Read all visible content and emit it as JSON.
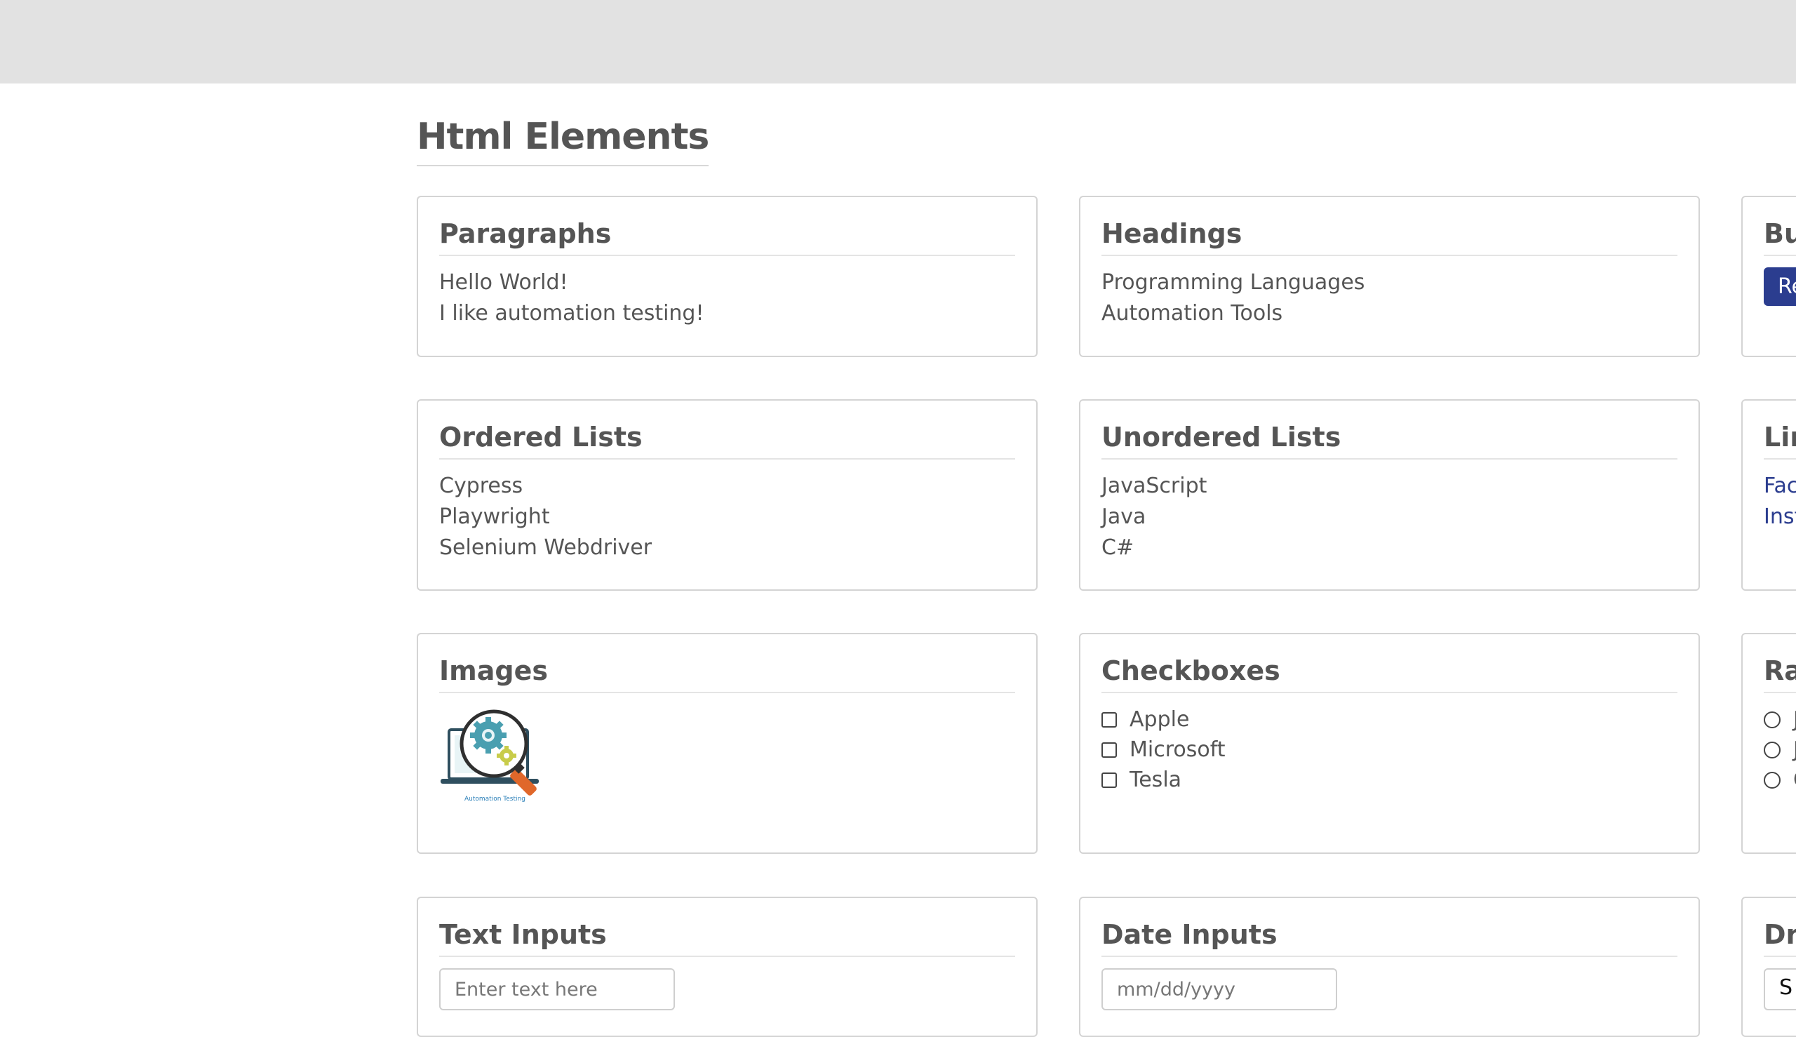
{
  "page": {
    "title": "Html Elements"
  },
  "cards": {
    "paragraphs": {
      "title": "Paragraphs",
      "lines": [
        "Hello World!",
        "I like automation testing!"
      ]
    },
    "headings": {
      "title": "Headings",
      "lines": [
        "Programming Languages",
        "Automation Tools"
      ]
    },
    "buttons": {
      "title": "Bu",
      "button_label": "Re"
    },
    "ordered_lists": {
      "title": "Ordered Lists",
      "items": [
        "Cypress",
        "Playwright",
        "Selenium Webdriver"
      ]
    },
    "unordered_lists": {
      "title": "Unordered Lists",
      "items": [
        "JavaScript",
        "Java",
        "C#"
      ]
    },
    "links": {
      "title": "Lin",
      "items": [
        "Fac",
        "Inst"
      ]
    },
    "images": {
      "title": "Images",
      "image_caption": "Automation Testing"
    },
    "checkboxes": {
      "title": "Checkboxes",
      "items": [
        "Apple",
        "Microsoft",
        "Tesla"
      ]
    },
    "radio": {
      "title": "Ra",
      "items": [
        "J",
        "J",
        "C"
      ]
    },
    "text_inputs": {
      "title": "Text Inputs",
      "placeholder": "Enter text here"
    },
    "date_inputs": {
      "title": "Date Inputs",
      "placeholder": "mm/dd/yyyy"
    },
    "dropdown": {
      "title": "Dr",
      "selected": "S"
    }
  },
  "colors": {
    "topbar": "#e2e2e2",
    "accent": "#2b3d8f",
    "text": "#555555"
  }
}
